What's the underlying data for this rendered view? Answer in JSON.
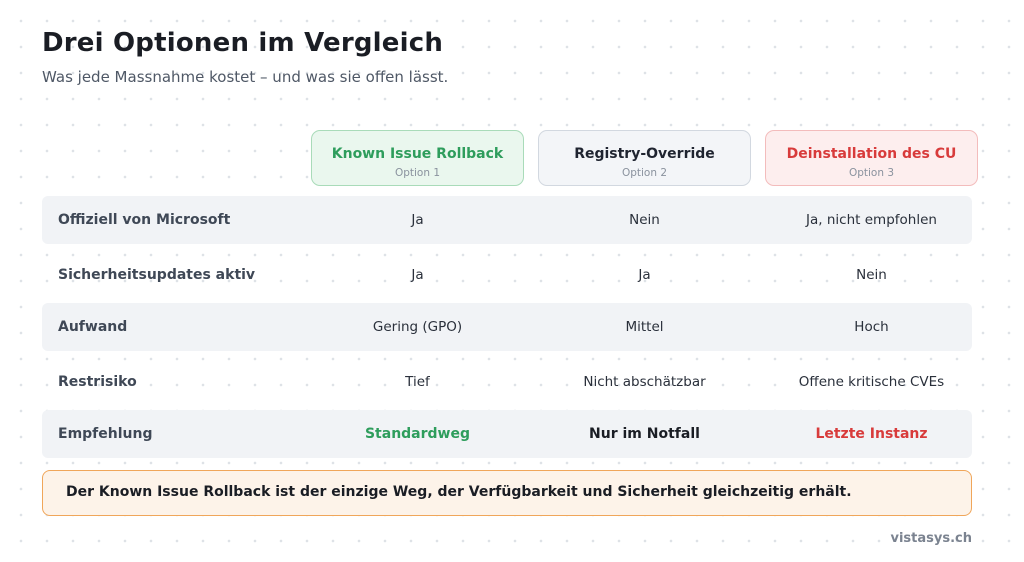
{
  "header": {
    "title": "Drei Optionen im Vergleich",
    "subtitle": "Was jede Massnahme kostet – und was sie offen lässt."
  },
  "options": [
    {
      "name": "Known Issue Rollback",
      "sub": "Option 1",
      "accent": "#2e9d5c"
    },
    {
      "name": "Registry-Override",
      "sub": "Option 2",
      "accent": "#1f2430"
    },
    {
      "name": "Deinstallation des CU",
      "sub": "Option 3",
      "accent": "#d83b3b"
    }
  ],
  "rows": [
    {
      "label": "Offiziell von Microsoft",
      "values": [
        "Ja",
        "Nein",
        "Ja, nicht empfohlen"
      ]
    },
    {
      "label": "Sicherheitsupdates aktiv",
      "values": [
        "Ja",
        "Ja",
        "Nein"
      ]
    },
    {
      "label": "Aufwand",
      "values": [
        "Gering (GPO)",
        "Mittel",
        "Hoch"
      ]
    },
    {
      "label": "Restrisiko",
      "values": [
        "Tief",
        "Nicht abschätzbar",
        "Offene kritische CVEs"
      ]
    },
    {
      "label": "Empfehlung",
      "values": [
        "Standardweg",
        "Nur im Notfall",
        "Letzte Instanz"
      ]
    }
  ],
  "note": "Der Known Issue Rollback ist der einzige Weg, der Verfügbarkeit und Sicherheit gleichzeitig erhält.",
  "brand": "vistasys.ch",
  "colors": {
    "green": "#2e9d5c",
    "red": "#d83b3b",
    "note_border": "#f0a65a",
    "note_bg": "#fdf3e9",
    "row_shade": "#f1f3f6"
  }
}
